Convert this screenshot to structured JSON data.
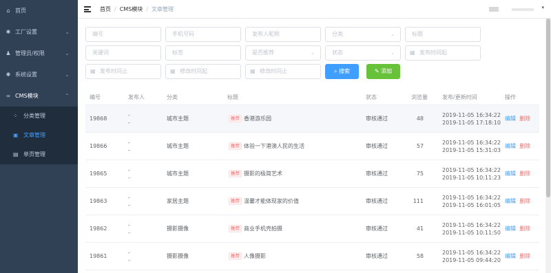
{
  "sidebar": {
    "items": [
      {
        "label": "首页",
        "icon": "home-icon"
      },
      {
        "label": "工厂设置",
        "icon": "gear-icon"
      },
      {
        "label": "管理员/权限",
        "icon": "user-icon"
      },
      {
        "label": "系统设置",
        "icon": "gear-icon"
      },
      {
        "label": "CMS模块",
        "icon": "link-icon"
      }
    ],
    "sub_items": [
      {
        "label": "分类管理"
      },
      {
        "label": "文章管理"
      },
      {
        "label": "单页管理"
      }
    ]
  },
  "header": {
    "breadcrumb": [
      "首页",
      "CMS模块",
      "文章管理"
    ],
    "breadcrumb_sep": "/"
  },
  "filters": {
    "row1": [
      "编号",
      "手机号码",
      "发布人昵称",
      "分类",
      "标题"
    ],
    "row2": [
      "关键词",
      "标签",
      "是否推荐",
      "状态",
      "发布时间起"
    ],
    "row3": [
      "发布时间止",
      "修改时间起",
      "修改时间止"
    ],
    "search_label": "搜索",
    "add_label": "添加"
  },
  "table": {
    "headers": [
      "编号",
      "发布人",
      "分类",
      "标题",
      "状态",
      "浏览量",
      "发布/更新时间",
      "操作"
    ],
    "tag_label": "推荐",
    "edit_label": "编辑",
    "delete_label": "删除",
    "rows": [
      {
        "id": "19868",
        "pub1": "-",
        "pub2": "-",
        "category": "城市主题",
        "title": "香港游乐园",
        "status": "审核通过",
        "views": "48",
        "created": "2019-11-05 16:34:22",
        "updated": "2019-11-05 17:18:10"
      },
      {
        "id": "19866",
        "pub1": "-",
        "pub2": "-",
        "category": "城市主题",
        "title": "体验一下港澳人民的生活",
        "status": "审核通过",
        "views": "57",
        "created": "2019-11-05 16:34:22",
        "updated": "2019-11-05 15:31:03"
      },
      {
        "id": "19865",
        "pub1": "-",
        "pub2": "-",
        "category": "城市主题",
        "title": "摄影的极简艺术",
        "status": "审核通过",
        "views": "75",
        "created": "2019-11-05 16:34:22",
        "updated": "2019-11-05 10:11:23"
      },
      {
        "id": "19863",
        "pub1": "-",
        "pub2": "-",
        "category": "家居主题",
        "title": "温馨才能体现家的价值",
        "status": "审核通过",
        "views": "111",
        "created": "2019-11-05 16:34:22",
        "updated": "2019-11-05 16:01:05"
      },
      {
        "id": "19862",
        "pub1": "-",
        "pub2": "-",
        "category": "摄影摄像",
        "title": "商业手机壳拍摄",
        "status": "审核通过",
        "views": "41",
        "created": "2019-11-05 16:34:22",
        "updated": "2019-11-05 10:11:50"
      },
      {
        "id": "19861",
        "pub1": "-",
        "pub2": "-",
        "category": "摄影摄像",
        "title": "人像摄影",
        "status": "审核通过",
        "views": "58",
        "created": "2019-11-05 16:34:22",
        "updated": "2019-11-05 09:44:20"
      }
    ]
  }
}
